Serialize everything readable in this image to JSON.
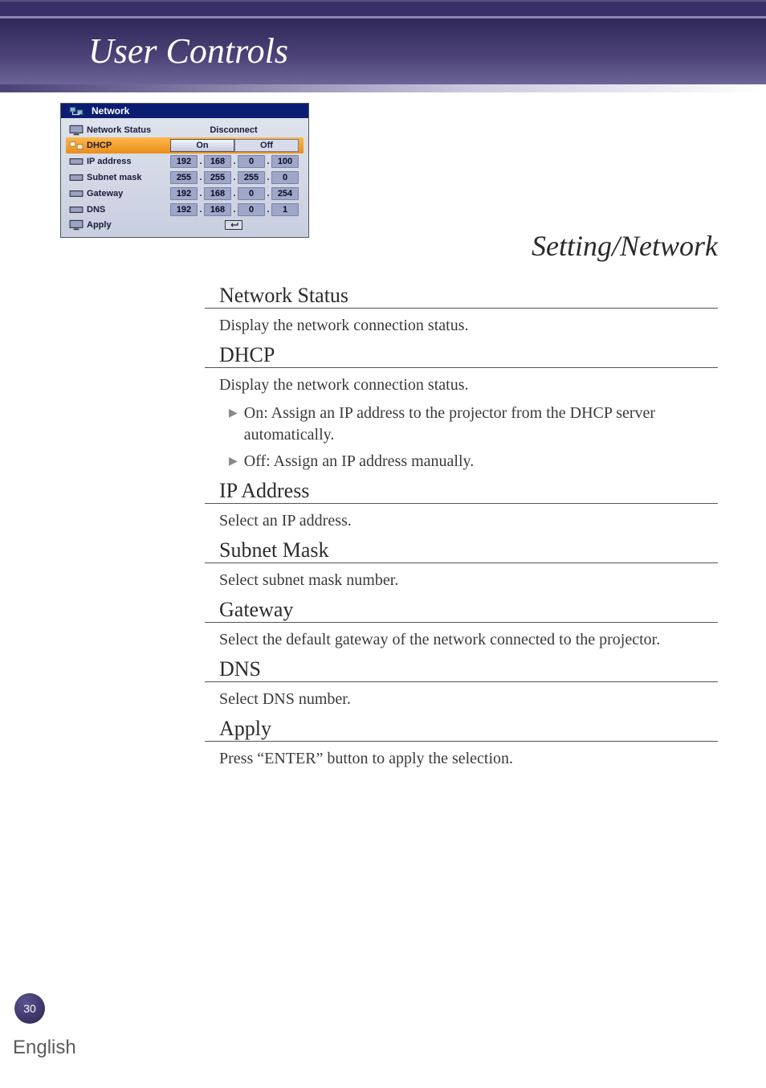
{
  "header": {
    "title": "User Controls"
  },
  "panel": {
    "title": "Network",
    "rows": {
      "status": {
        "label": "Network Status",
        "value": "Disconnect"
      },
      "dhcp": {
        "label": "DHCP",
        "on": "On",
        "off": "Off"
      },
      "ip": {
        "label": "IP address",
        "o1": "192",
        "o2": "168",
        "o3": "0",
        "o4": "100"
      },
      "subnet": {
        "label": "Subnet mask",
        "o1": "255",
        "o2": "255",
        "o3": "255",
        "o4": "0"
      },
      "gateway": {
        "label": "Gateway",
        "o1": "192",
        "o2": "168",
        "o3": "0",
        "o4": "254"
      },
      "dns": {
        "label": "DNS",
        "o1": "192",
        "o2": "168",
        "o3": "0",
        "o4": "1"
      },
      "apply": {
        "label": "Apply"
      }
    }
  },
  "right_heading": "Setting/Network",
  "sections": {
    "network_status": {
      "title": "Network Status",
      "body": "Display the network connection status."
    },
    "dhcp": {
      "title": "DHCP",
      "body": "Display the network connection status.",
      "bullets": [
        "On: Assign an IP address to the projector from the DHCP server automatically.",
        "Off: Assign an IP address manually."
      ]
    },
    "ip_address": {
      "title": "IP Address",
      "body": "Select an IP address."
    },
    "subnet_mask": {
      "title": "Subnet Mask",
      "body": "Select subnet mask number."
    },
    "gateway": {
      "title": "Gateway",
      "body": "Select the default gateway of the network connected to the projector."
    },
    "dns": {
      "title": "DNS",
      "body": "Select DNS number."
    },
    "apply": {
      "title": "Apply",
      "body": "Press “ENTER” button to apply the selection."
    }
  },
  "footer": {
    "page": "30",
    "language": "English"
  }
}
